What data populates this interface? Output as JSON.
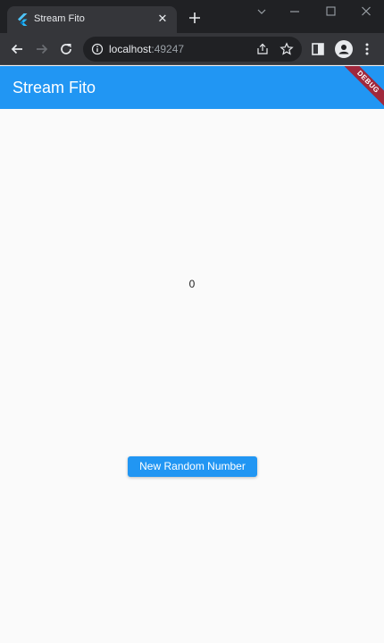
{
  "browser": {
    "tab_title": "Stream Fito",
    "tab_close": "✕",
    "url_host": "localhost",
    "url_port": ":49247"
  },
  "app": {
    "title": "Stream Fito",
    "debug_banner": "DEBUG",
    "counter_value": "0",
    "button_label": "New Random Number"
  },
  "colors": {
    "primary": "#2196f3",
    "debug_ribbon": "#a0283c",
    "chrome_dark": "#202124",
    "chrome_toolbar": "#35363a"
  }
}
